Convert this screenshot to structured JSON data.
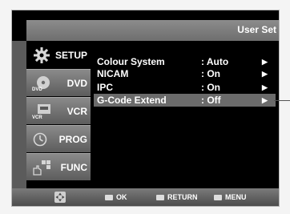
{
  "header": {
    "title": "User Set"
  },
  "sidebar": {
    "items": [
      {
        "label": "SETUP",
        "icon": "gear-icon",
        "active": true
      },
      {
        "label": "DVD",
        "icon": "dvd-icon",
        "icon_text": "DVD",
        "active": false
      },
      {
        "label": "VCR",
        "icon": "vcr-icon",
        "icon_text": "VCR",
        "active": false
      },
      {
        "label": "PROG",
        "icon": "clock-icon",
        "active": false
      },
      {
        "label": "FUNC",
        "icon": "function-icon",
        "active": false
      }
    ]
  },
  "settings": [
    {
      "name": "Colour System",
      "value": ": Auto",
      "arrow": "▶"
    },
    {
      "name": "NICAM",
      "value": ": On",
      "arrow": "▶"
    },
    {
      "name": "IPC",
      "value": ": On",
      "arrow": "▶"
    },
    {
      "name": "G-Code Extend",
      "value": ": Off",
      "arrow": "▶",
      "selected": true
    }
  ],
  "footer": {
    "nav_icon": "navigation-pad-icon",
    "ok_label": "OK",
    "return_label": "RETURN",
    "menu_label": "MENU"
  },
  "colors": {
    "background": "#000000",
    "selected_row": "#6b6b6b",
    "text": "#ffffff"
  }
}
